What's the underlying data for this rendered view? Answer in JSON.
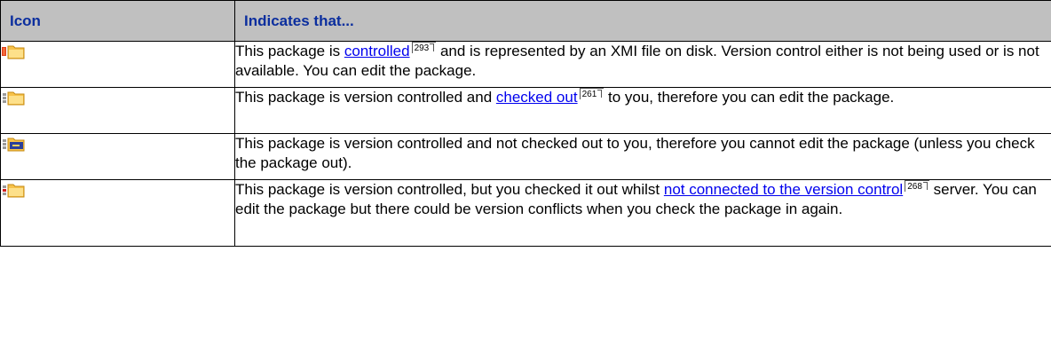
{
  "table": {
    "headers": [
      "Icon",
      "Indicates that..."
    ],
    "rows": [
      {
        "icon": "package-controlled-xmi-icon",
        "text_a": "This package is ",
        "link": "controlled",
        "pageref": "293",
        "text_b": " and is represented by an XMI file on disk. Version control either is not being used or is not available. You can edit the package."
      },
      {
        "icon": "package-checked-out-icon",
        "text_a": "This package is version controlled and ",
        "link": "checked out",
        "pageref": "261",
        "text_b": " to you, therefore you can edit the package."
      },
      {
        "icon": "package-locked-icon",
        "text_a": "This package is version controlled and not checked out to you, therefore you cannot edit the package (unless you check the package out)."
      },
      {
        "icon": "package-offline-checked-out-icon",
        "text_a": "This package is version controlled, but you checked it out whilst ",
        "link": "not connected to the version control",
        "pageref": "268",
        "text_b": " server. You can edit the package but there could be version conflicts when you check the package in again."
      }
    ]
  },
  "colors": {
    "header_bg": "#c0c0c0",
    "header_text": "#0b2e9e",
    "link": "#0000ee"
  }
}
